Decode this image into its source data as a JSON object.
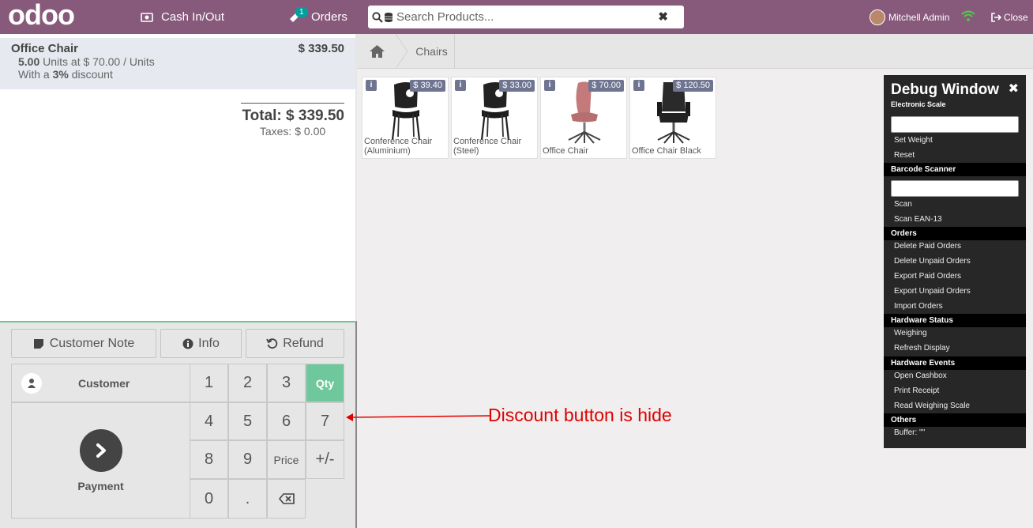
{
  "topbar": {
    "logo": "odoo",
    "cash_label": "Cash In/Out",
    "orders_label": "Orders",
    "orders_badge": "1",
    "search_placeholder": "Search Products...",
    "user_name": "Mitchell Admin",
    "close_label": "Close"
  },
  "order": {
    "line": {
      "name": "Office Chair",
      "price": "$ 339.50",
      "quantity": "5.00",
      "qty_text": "Units at $ 70.00 / Units",
      "discount_prefix": "With a",
      "discount": "3%",
      "discount_suffix": "discount"
    },
    "total": "Total: $ 339.50",
    "taxes": "Taxes: $ 0.00"
  },
  "controls": {
    "customer_note": "Customer Note",
    "info": "Info",
    "refund": "Refund",
    "customer": "Customer",
    "payment": "Payment",
    "keys": [
      "1",
      "2",
      "3",
      "Qty",
      "4",
      "5",
      "6",
      "7",
      "8",
      "9",
      "Price",
      "+/-",
      "0",
      "."
    ]
  },
  "breadcrumb": {
    "category": "Chairs"
  },
  "products": [
    {
      "name": "Conference Chair (Aluminium)",
      "price": "$ 39.40"
    },
    {
      "name": "Conference Chair (Steel)",
      "price": "$ 33.00"
    },
    {
      "name": "Office Chair",
      "price": "$ 70.00"
    },
    {
      "name": "Office Chair Black",
      "price": "$ 120.50"
    }
  ],
  "debug": {
    "title": "Debug Window",
    "electronic_scale": "Electronic Scale",
    "set_weight": "Set Weight",
    "reset": "Reset",
    "barcode_scanner": "Barcode Scanner",
    "scan": "Scan",
    "scan_ean": "Scan EAN-13",
    "orders": "Orders",
    "delete_paid": "Delete Paid Orders",
    "delete_unpaid": "Delete Unpaid Orders",
    "export_paid": "Export Paid Orders",
    "export_unpaid": "Export Unpaid Orders",
    "import_orders": "Import Orders",
    "hardware_status": "Hardware Status",
    "weighing": "Weighing",
    "refresh_display": "Refresh Display",
    "hardware_events": "Hardware Events",
    "open_cashbox": "Open Cashbox",
    "print_receipt": "Print Receipt",
    "read_weighing": "Read Weighing Scale",
    "others": "Others",
    "buffer": "Buffer: \"\""
  },
  "annotation": "Discount button is hide",
  "colors": {
    "topbar": "#875a7b",
    "qty_active": "#6ec89b",
    "price_tag": "#6f7591",
    "annotation": "#e00000"
  }
}
